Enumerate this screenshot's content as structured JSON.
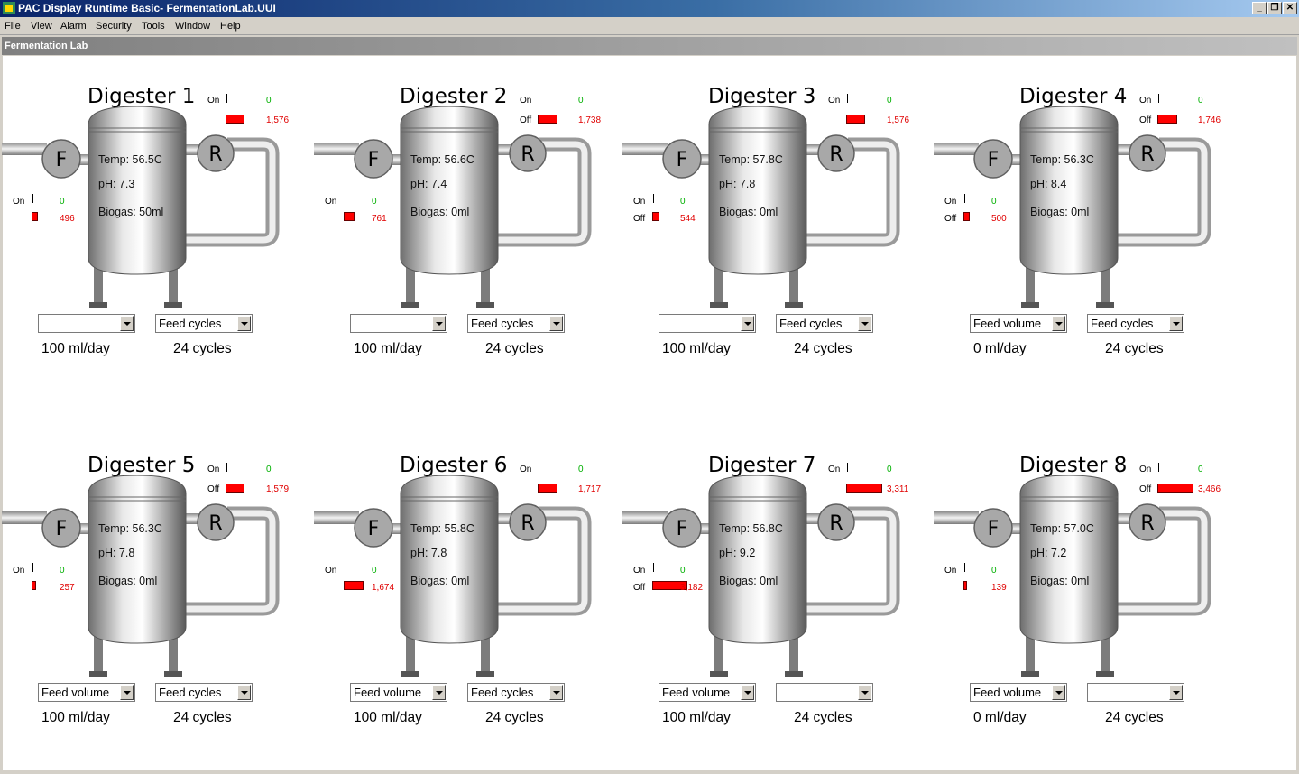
{
  "window": {
    "title": "PAC Display Runtime Basic- FermentationLab.UUI"
  },
  "menu": [
    "File",
    "View",
    "Alarm",
    "Security",
    "Tools",
    "Window",
    "Help"
  ],
  "document": {
    "title": "Fermentation Lab"
  },
  "labels": {
    "on": "On",
    "off": "Off",
    "feeder": "F",
    "recirc": "R"
  },
  "digesters": [
    {
      "name": "Digester 1",
      "temp": "Temp: 56.5C",
      "ph": "pH: 7.3",
      "biogas": "Biogas: 50ml",
      "r": {
        "on_label": "On",
        "on_count": "0",
        "off_label": "",
        "off_count": "1,576",
        "level": 0.46
      },
      "f": {
        "on_label": "On",
        "on_count": "0",
        "off_label": "",
        "off_count": "496",
        "level": 0.07
      },
      "feed_select": "",
      "feed_value": "100 ml/day",
      "cycles_select": "Feed cycles",
      "cycles_value": "24 cycles"
    },
    {
      "name": "Digester 2",
      "temp": "Temp: 56.6C",
      "ph": "pH: 7.4",
      "biogas": "Biogas: 0ml",
      "r": {
        "on_label": "On",
        "on_count": "0",
        "off_label": "Off",
        "off_count": "1,738",
        "level": 0.51
      },
      "f": {
        "on_label": "On",
        "on_count": "0",
        "off_label": "",
        "off_count": "761",
        "level": 0.22
      },
      "feed_select": "",
      "feed_value": "100 ml/day",
      "cycles_select": "Feed cycles",
      "cycles_value": "24 cycles"
    },
    {
      "name": "Digester 3",
      "temp": "Temp: 57.8C",
      "ph": "pH: 7.8",
      "biogas": "Biogas: 0ml",
      "r": {
        "on_label": "On",
        "on_count": "0",
        "off_label": "",
        "off_count": "1,576",
        "level": 0.46
      },
      "f": {
        "on_label": "On",
        "on_count": "0",
        "off_label": "Off",
        "off_count": "544",
        "level": 0.12
      },
      "feed_select": "",
      "feed_value": "100 ml/day",
      "cycles_select": "Feed cycles",
      "cycles_value": "24 cycles"
    },
    {
      "name": "Digester 4",
      "temp": "Temp: 56.3C",
      "ph": "pH: 8.4",
      "biogas": "Biogas: 0ml",
      "r": {
        "on_label": "On",
        "on_count": "0",
        "off_label": "Off",
        "off_count": "1,746",
        "level": 0.51
      },
      "f": {
        "on_label": "On",
        "on_count": "0",
        "off_label": "Off",
        "off_count": "500",
        "level": 0.08
      },
      "feed_select": "Feed volume",
      "feed_value": "0 ml/day",
      "cycles_select": "Feed cycles",
      "cycles_value": "24 cycles"
    },
    {
      "name": "Digester 5",
      "temp": "Temp: 56.3C",
      "ph": "pH: 7.8",
      "biogas": "Biogas: 0ml",
      "r": {
        "on_label": "On",
        "on_count": "0",
        "off_label": "Off",
        "off_count": "1,579",
        "level": 0.46
      },
      "f": {
        "on_label": "On",
        "on_count": "0",
        "off_label": "",
        "off_count": "257",
        "level": 0.02
      },
      "feed_select": "Feed volume",
      "feed_value": "100 ml/day",
      "cycles_select": "Feed cycles",
      "cycles_value": "24 cycles"
    },
    {
      "name": "Digester 6",
      "temp": "Temp: 55.8C",
      "ph": "pH: 7.8",
      "biogas": "Biogas: 0ml",
      "r": {
        "on_label": "On",
        "on_count": "0",
        "off_label": "",
        "off_count": "1,717",
        "level": 0.5
      },
      "f": {
        "on_label": "On",
        "on_count": "0",
        "off_label": "",
        "off_count": "1,674",
        "level": 0.49
      },
      "feed_select": "Feed volume",
      "feed_value": "100 ml/day",
      "cycles_select": "Feed cycles",
      "cycles_value": "24 cycles"
    },
    {
      "name": "Digester 7",
      "temp": "Temp: 56.8C",
      "ph": "pH: 9.2",
      "biogas": "Biogas: 0ml",
      "r": {
        "on_label": "On",
        "on_count": "0",
        "off_label": "",
        "off_count": "3,311",
        "level": 1.0
      },
      "f": {
        "on_label": "On",
        "on_count": "0",
        "off_label": "Off",
        "off_count": "3,182",
        "level": 0.96
      },
      "feed_select": "Feed volume",
      "feed_value": "100 ml/day",
      "cycles_select": "",
      "cycles_value": "24 cycles"
    },
    {
      "name": "Digester 8",
      "temp": "Temp: 57.0C",
      "ph": "pH: 7.2",
      "biogas": "Biogas: 0ml",
      "r": {
        "on_label": "On",
        "on_count": "0",
        "off_label": "Off",
        "off_count": "3,466",
        "level": 1.0
      },
      "f": {
        "on_label": "On",
        "on_count": "0",
        "off_label": "",
        "off_count": "139",
        "level": 0.01
      },
      "feed_select": "Feed volume",
      "feed_value": "0 ml/day",
      "cycles_select": "",
      "cycles_value": "24 cycles"
    }
  ]
}
